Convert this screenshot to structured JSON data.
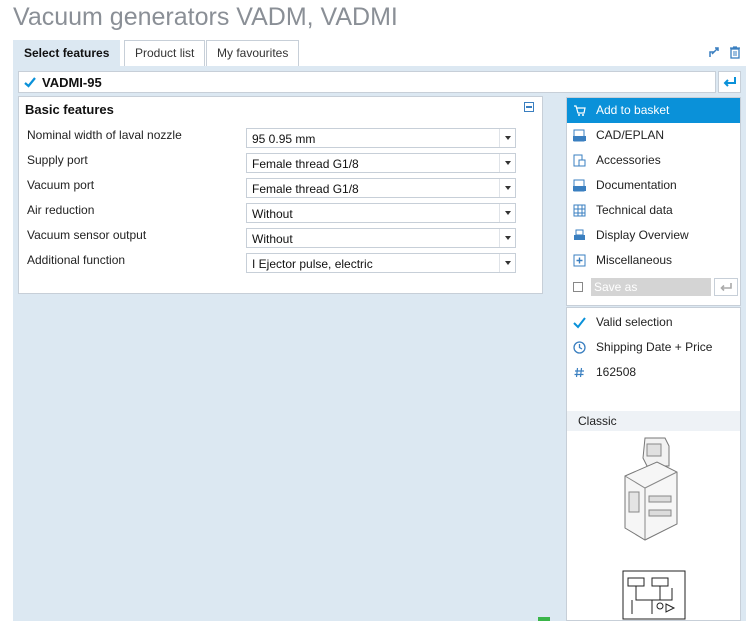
{
  "page": {
    "title": "Vacuum generators VADM, VADMI"
  },
  "tabs": [
    {
      "label": "Select features",
      "active": true
    },
    {
      "label": "Product list",
      "active": false
    },
    {
      "label": "My favourites",
      "active": false
    }
  ],
  "tab_icons": [
    "share-icon",
    "trash-icon"
  ],
  "code_bar": {
    "value": "VADMI-95"
  },
  "features": {
    "title": "Basic features",
    "rows": [
      {
        "label": "Nominal width of laval nozzle",
        "value": "95 0.95 mm"
      },
      {
        "label": "Supply port",
        "value": "Female thread G1/8"
      },
      {
        "label": "Vacuum port",
        "value": "Female thread G1/8"
      },
      {
        "label": "Air reduction",
        "value": "Without"
      },
      {
        "label": "Vacuum sensor output",
        "value": "Without"
      },
      {
        "label": "Additional function",
        "value": "I Ejector pulse, electric"
      }
    ]
  },
  "actions": [
    {
      "label": "Add to basket",
      "icon": "basket-icon",
      "primary": true
    },
    {
      "label": "CAD/EPLAN",
      "icon": "cad-icon",
      "primary": false
    },
    {
      "label": "Accessories",
      "icon": "accessories-icon",
      "primary": false
    },
    {
      "label": "Documentation",
      "icon": "pdf-icon",
      "primary": false
    },
    {
      "label": "Technical data",
      "icon": "table-icon",
      "primary": false
    },
    {
      "label": "Display Overview",
      "icon": "print-icon",
      "primary": false
    },
    {
      "label": "Miscellaneous",
      "icon": "plus-box-icon",
      "primary": false
    }
  ],
  "save": {
    "placeholder": "Save as"
  },
  "status": [
    {
      "label": "Valid selection",
      "icon": "check-icon"
    },
    {
      "label": "Shipping Date + Price",
      "icon": "clock-icon"
    },
    {
      "label": "162508",
      "icon": "hash-icon"
    }
  ],
  "variant": {
    "label": "Classic"
  },
  "colors": {
    "accent": "#0a91d9",
    "panel_bg": "#dce8f2",
    "title": "#8a8f96"
  }
}
